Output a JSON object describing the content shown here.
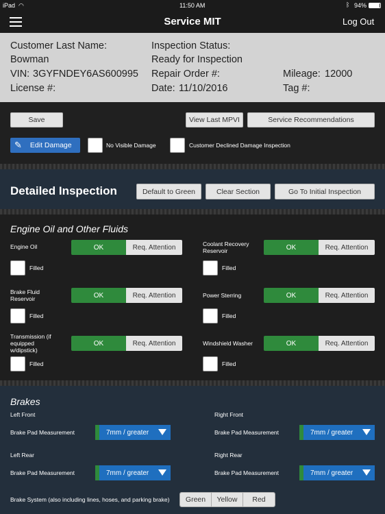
{
  "status_bar": {
    "carrier": "iPad",
    "time": "11:50 AM",
    "battery": "94%"
  },
  "nav": {
    "title": "Service MIT",
    "logout": "Log Out"
  },
  "customer": {
    "last_name_label": "Customer Last Name:",
    "last_name": "Bowman",
    "vin_label": "VIN:",
    "vin": "3GYFNDEY6AS600995",
    "license_label": "License #:",
    "license": "",
    "status_label": "Inspection Status:",
    "status": "Ready for Inspection",
    "repair_order_label": "Repair Order #:",
    "repair_order": "",
    "date_label": "Date:",
    "date": "11/10/2016",
    "mileage_label": "Mileage:",
    "mileage": "12000",
    "tag_label": "Tag #:",
    "tag": ""
  },
  "actions": {
    "save": "Save",
    "view_last": "View Last MPVI",
    "recommendations": "Service Recommendations",
    "edit_damage": "Edit Damage",
    "no_visible_damage": "No Visible Damage",
    "customer_declined": "Customer Declined Damage Inspection"
  },
  "detail": {
    "title": "Detailed Inspection",
    "default_green": "Default to Green",
    "clear_section": "Clear Section",
    "go_initial": "Go To Initial Inspection"
  },
  "fluids": {
    "title": "Engine Oil and Other Fluids",
    "ok": "OK",
    "req": "Req. Attention",
    "filled": "Filled",
    "items": [
      {
        "name": "Engine Oil"
      },
      {
        "name": "Coolant Recovery Reservoir"
      },
      {
        "name": "Brake Fluid Reservoir"
      },
      {
        "name": "Power Sterring"
      },
      {
        "name": "Transmission (if equipped w/dipstick)"
      },
      {
        "name": "Windshield Washer"
      }
    ]
  },
  "brakes": {
    "title": "Brakes",
    "pad_label": "Brake Pad Measurement",
    "wheels": [
      {
        "position": "Left Front",
        "value": "7mm / greater"
      },
      {
        "position": "Right Front",
        "value": "7mm / greater"
      },
      {
        "position": "Left Rear",
        "value": "7mm / greater"
      },
      {
        "position": "Right Rear",
        "value": "7mm / greater"
      }
    ],
    "system_label": "Brake System (also including lines, hoses, and parking brake)",
    "green": "Green",
    "yellow": "Yellow",
    "red": "Red"
  },
  "colors": {
    "ok_green": "#2f8a3c",
    "dropdown_blue": "#1f6fbf",
    "edit_blue": "#2f6fbf",
    "header_dark": "#1b1b1b",
    "section_navy": "#232f3c"
  }
}
